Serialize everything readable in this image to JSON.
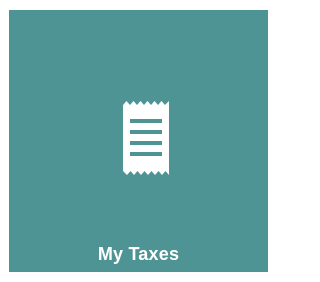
{
  "tile": {
    "label": "My Taxes",
    "icon": "receipt-icon",
    "background_color": "#4f9494",
    "foreground_color": "#ffffff"
  }
}
